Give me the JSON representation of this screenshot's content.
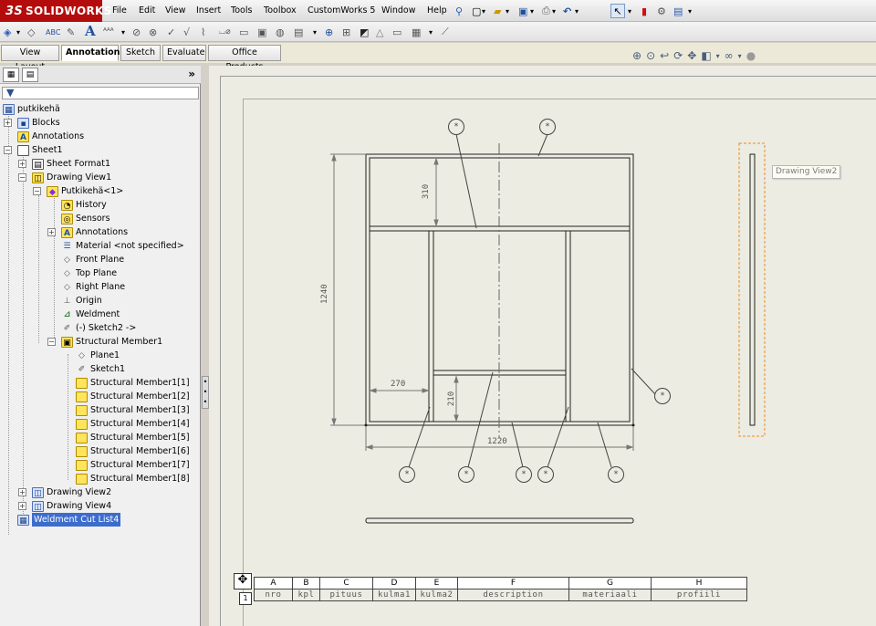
{
  "app": {
    "logo_prefix": "3S",
    "logo_text": "SOLIDWORKS"
  },
  "menu": [
    "File",
    "Edit",
    "View",
    "Insert",
    "Tools",
    "Toolbox",
    "CustomWorks 5",
    "Window",
    "Help"
  ],
  "command_tabs": [
    {
      "label": "View Layout",
      "active": false
    },
    {
      "label": "Annotation",
      "active": true
    },
    {
      "label": "Sketch",
      "active": false
    },
    {
      "label": "Evaluate",
      "active": false
    },
    {
      "label": "Office Products",
      "active": false
    }
  ],
  "tree": {
    "root": "putkikehä",
    "items": [
      {
        "label": "Blocks",
        "icon": "blocks-icon"
      },
      {
        "label": "Annotations",
        "icon": "annotations-icon"
      },
      {
        "label": "Sheet1",
        "icon": "sheet-icon"
      },
      {
        "label": "Sheet Format1",
        "icon": "sheet-format-icon"
      },
      {
        "label": "Drawing View1",
        "icon": "drawing-view-icon"
      },
      {
        "label": "Putkikehä<1>",
        "icon": "part-icon"
      },
      {
        "label": "History",
        "icon": "history-icon"
      },
      {
        "label": "Sensors",
        "icon": "sensors-icon"
      },
      {
        "label": "Annotations",
        "icon": "annotations-icon"
      },
      {
        "label": "Material <not specified>",
        "icon": "material-icon"
      },
      {
        "label": "Front Plane",
        "icon": "plane-icon"
      },
      {
        "label": "Top Plane",
        "icon": "plane-icon"
      },
      {
        "label": "Right Plane",
        "icon": "plane-icon"
      },
      {
        "label": "Origin",
        "icon": "origin-icon"
      },
      {
        "label": "Weldment",
        "icon": "weldment-icon"
      },
      {
        "label": "(-) Sketch2 ->",
        "icon": "sketch-icon"
      },
      {
        "label": "Structural Member1",
        "icon": "structural-member-icon"
      },
      {
        "label": "Plane1",
        "icon": "plane-icon"
      },
      {
        "label": "Sketch1",
        "icon": "sketch-icon"
      },
      {
        "label": "Structural Member1[1]",
        "icon": "body-icon"
      },
      {
        "label": "Structural Member1[2]",
        "icon": "body-icon"
      },
      {
        "label": "Structural Member1[3]",
        "icon": "body-icon"
      },
      {
        "label": "Structural Member1[4]",
        "icon": "body-icon"
      },
      {
        "label": "Structural Member1[5]",
        "icon": "body-icon"
      },
      {
        "label": "Structural Member1[6]",
        "icon": "body-icon"
      },
      {
        "label": "Structural Member1[7]",
        "icon": "body-icon"
      },
      {
        "label": "Structural Member1[8]",
        "icon": "body-icon"
      },
      {
        "label": "Drawing View2",
        "icon": "drawing-view-icon"
      },
      {
        "label": "Drawing View4",
        "icon": "drawing-view-icon"
      },
      {
        "label": "Weldment Cut List4",
        "icon": "cut-list-icon"
      }
    ]
  },
  "drawing": {
    "dims": {
      "h1240": "1240",
      "d310": "310",
      "d270": "270",
      "d210": "210",
      "w1220": "1220"
    },
    "balloon_text": "*",
    "tooltip": "Drawing View2"
  },
  "bom": {
    "letters": [
      "A",
      "B",
      "C",
      "D",
      "E",
      "F",
      "G",
      "H"
    ],
    "headers": [
      "nro",
      "kpl",
      "pituus",
      "kulma1",
      "kulma2",
      "description",
      "materiaali",
      "profiili"
    ],
    "row_index": "1"
  },
  "colors": {
    "logo_bg": "#b40c0c",
    "selection": "#3d6dcc",
    "sheet_bg": "#ecece2",
    "view_frame": "#f08a24"
  }
}
